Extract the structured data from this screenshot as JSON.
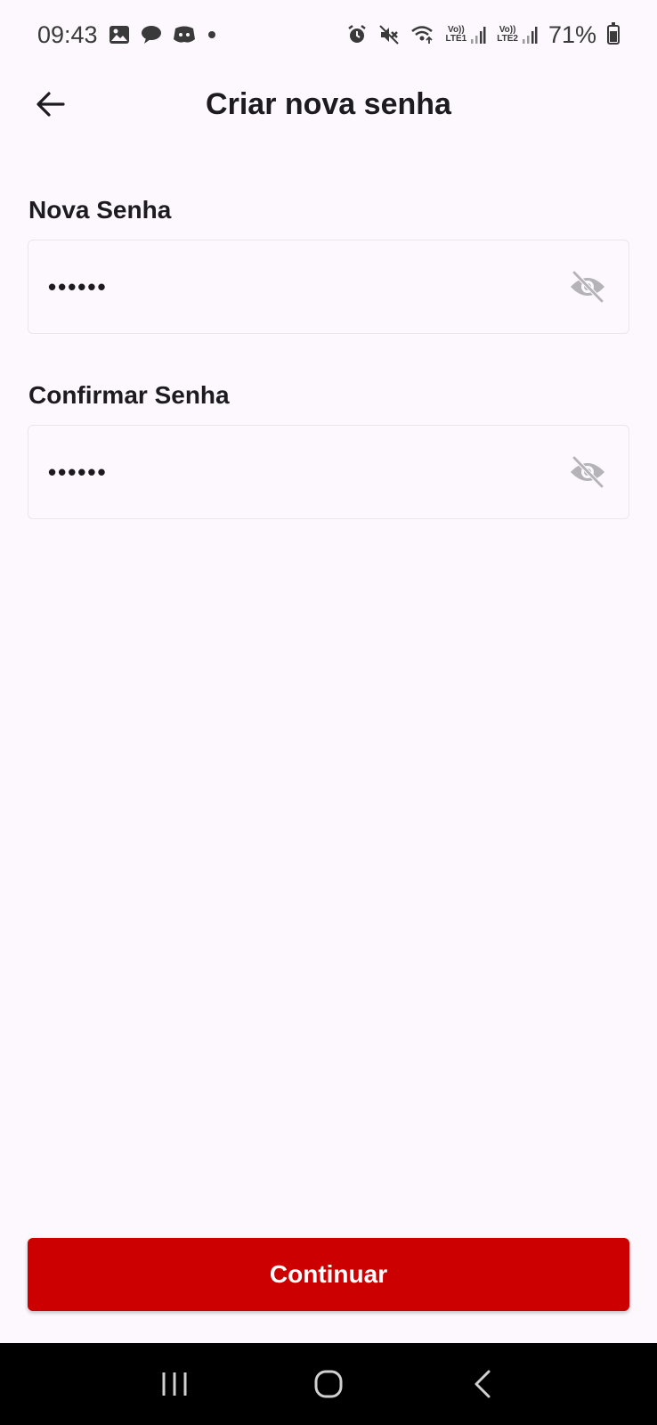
{
  "status_bar": {
    "time": "09:43",
    "battery": "71%",
    "sim1_label_top": "Vo))",
    "sim1_label_bottom": "LTE1",
    "sim2_label_top": "Vo))",
    "sim2_label_bottom": "LTE2",
    "left_icons": [
      "gallery-icon",
      "chat-icon",
      "discord-icon",
      "dot-icon"
    ],
    "right_icons": [
      "alarm-icon",
      "mute-icon",
      "wifi-icon",
      "signal-icon",
      "battery-icon"
    ]
  },
  "app_bar": {
    "title": "Criar nova senha",
    "back_icon": "arrow-left-icon"
  },
  "form": {
    "new_password": {
      "label": "Nova Senha",
      "value": "••••••",
      "toggle_icon": "eye-off-icon"
    },
    "confirm_password": {
      "label": "Confirmar Senha",
      "value": "••••••",
      "toggle_icon": "eye-off-icon"
    }
  },
  "actions": {
    "continue_label": "Continuar"
  },
  "colors": {
    "background": "#fcf8fd",
    "primary": "#cc0000",
    "text": "#1d1b20",
    "icon_muted": "#b5b3b8"
  }
}
